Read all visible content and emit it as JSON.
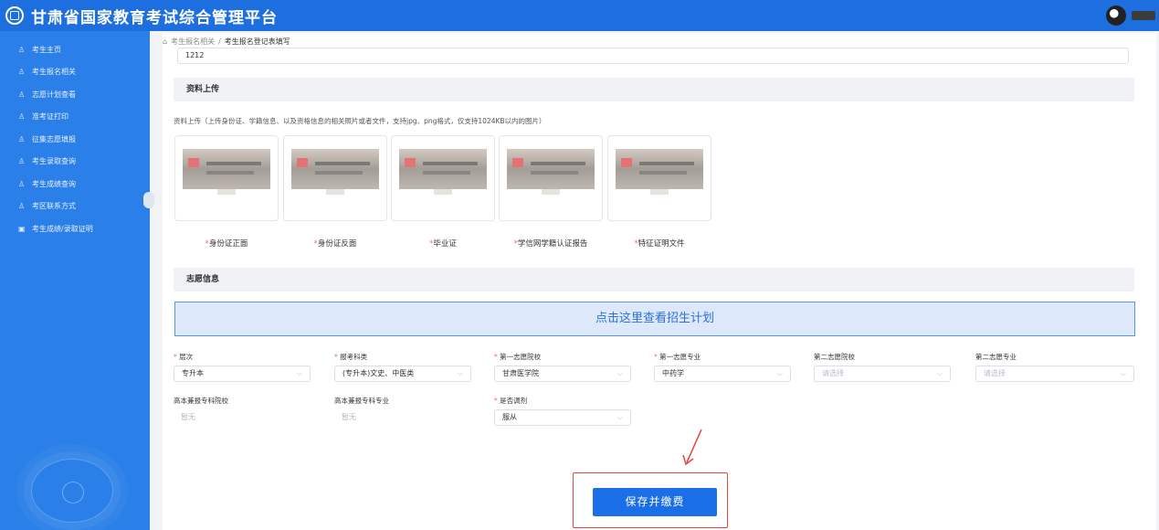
{
  "header": {
    "title": "甘肃省国家教育考试综合管理平台"
  },
  "sidebar": {
    "items": [
      {
        "label": "考生主页",
        "icon": "user-icon"
      },
      {
        "label": "考生报名相关",
        "icon": "user-icon"
      },
      {
        "label": "志愿计划查看",
        "icon": "user-icon"
      },
      {
        "label": "准考证打印",
        "icon": "user-icon"
      },
      {
        "label": "征集志愿填报",
        "icon": "user-icon"
      },
      {
        "label": "考生录取查询",
        "icon": "user-icon"
      },
      {
        "label": "考生成绩查询",
        "icon": "user-icon"
      },
      {
        "label": "考区联系方式",
        "icon": "user-icon"
      },
      {
        "label": "考生成绩/录取证明",
        "icon": "certificate-icon"
      }
    ]
  },
  "breadcrumb": {
    "parent": "考生报名相关",
    "separator": "/",
    "current": "考生报名登记表填写"
  },
  "form": {
    "previous_field_value": "1212",
    "upload_section_title": "资料上传",
    "upload_hint": "资料上传（上传身份证、学籍信息、以及资格信息的相关照片或者文件，支持jpg、png格式，仅支持1024KB以内的图片）",
    "uploads": [
      {
        "label": "身份证正面",
        "required": "*"
      },
      {
        "label": "身份证反面",
        "required": "*"
      },
      {
        "label": "毕业证",
        "required": "*"
      },
      {
        "label": "学信网学籍认证报告",
        "required": "*"
      },
      {
        "label": "特征证明文件",
        "required": "*"
      }
    ],
    "volunteer_section_title": "志愿信息",
    "plan_banner": "点击这里查看招生计划",
    "fields": {
      "level": {
        "label": "层次",
        "required": "*",
        "value": "专升本"
      },
      "subject_type": {
        "label": "报考科类",
        "required": "*",
        "value": "(专升本)文史、中医类"
      },
      "first_school": {
        "label": "第一志愿院校",
        "required": "*",
        "value": "甘肃医学院"
      },
      "first_major": {
        "label": "第一志愿专业",
        "required": "*",
        "value": "中药学"
      },
      "second_school": {
        "label": "第二志愿院校",
        "placeholder": "请选择"
      },
      "second_major": {
        "label": "第二志愿专业",
        "placeholder": "请选择"
      },
      "also_school": {
        "label": "高本兼报专科院校",
        "value": "暂无"
      },
      "also_major": {
        "label": "高本兼报专科专业",
        "value": "暂无"
      },
      "adjust": {
        "label": "是否调剂",
        "required": "*",
        "value": "服从"
      }
    },
    "save_button": "保存并缴费"
  },
  "colors": {
    "brand_blue": "#1d6fe0",
    "sidebar_blue": "#2a7fe8",
    "required_red": "#f56c6c",
    "highlight_red": "#e2453c",
    "button_blue": "#1a6ee8"
  }
}
